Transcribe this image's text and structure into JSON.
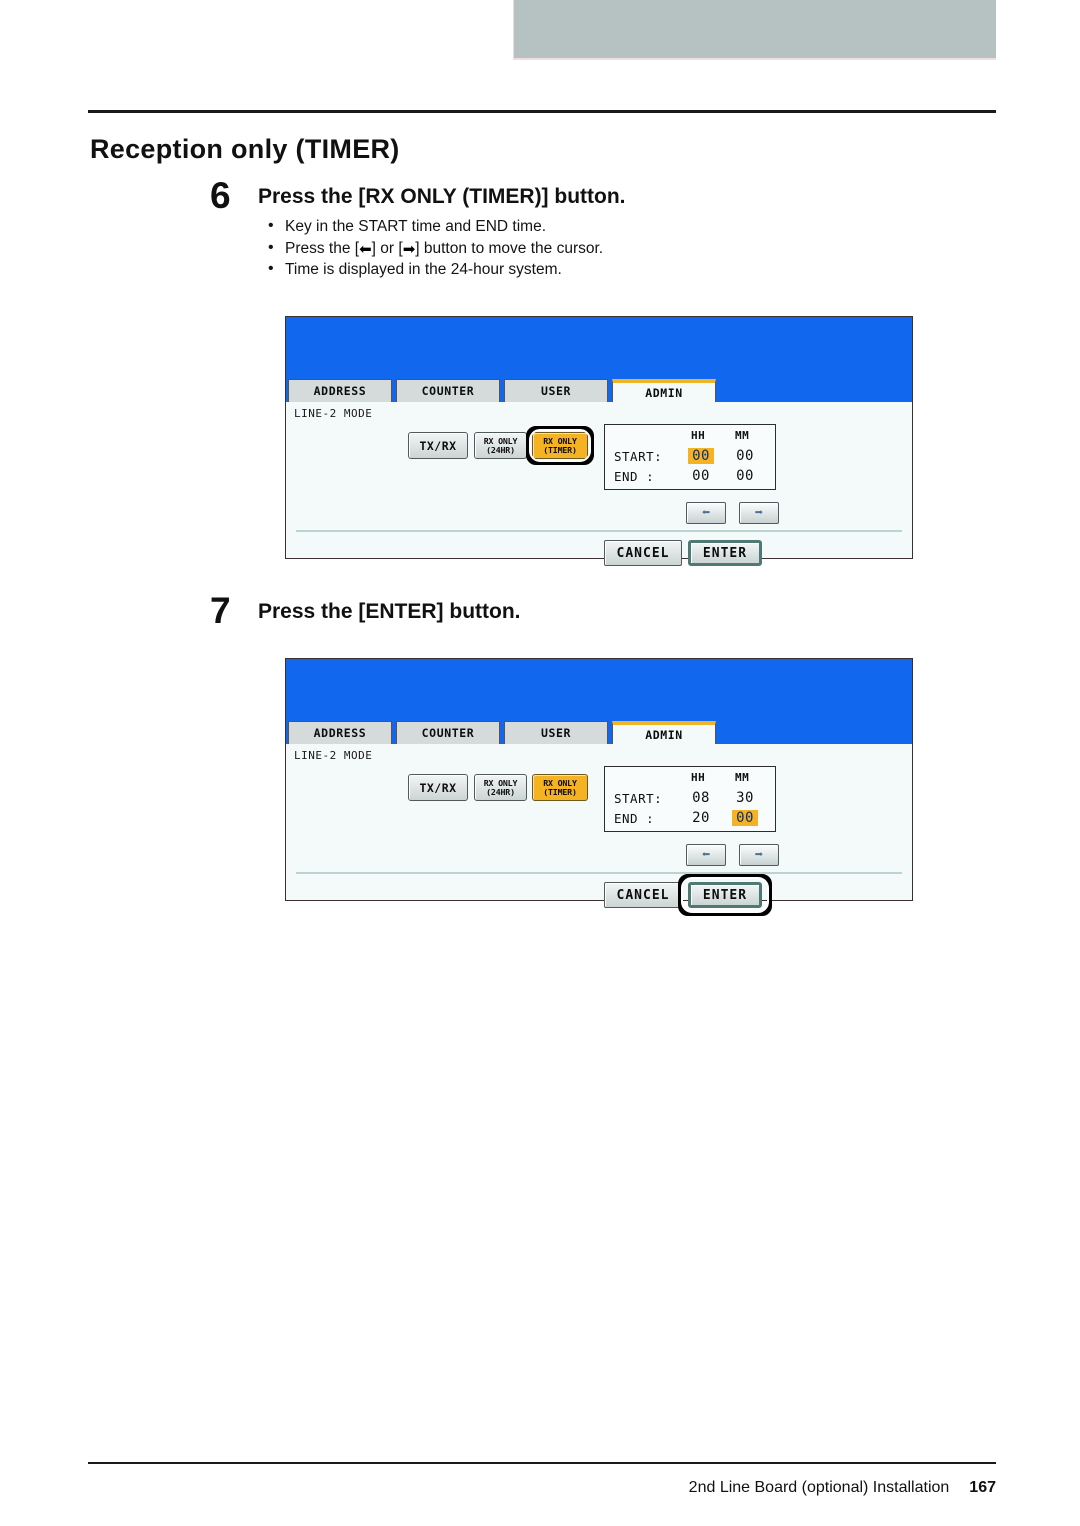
{
  "document": {
    "section_title": "Reception only (TIMER)",
    "footer_text": "2nd Line Board (optional) Installation",
    "footer_page": "167"
  },
  "steps": [
    {
      "number": "6",
      "title": "Press the [RX ONLY (TIMER)] button.",
      "bullets": [
        {
          "pre": "Key in the START time and END time.",
          "mid": "",
          "post": ""
        },
        {
          "pre": "Press the [",
          "left_arrow": "⬅",
          "mid": "] or [",
          "right_arrow": "➡",
          "post": "] button to move the cursor."
        },
        {
          "pre": "Time is displayed in the 24-hour system.",
          "mid": "",
          "post": ""
        }
      ]
    },
    {
      "number": "7",
      "title": "Press the [ENTER] button.",
      "bullets": []
    }
  ],
  "screens": [
    {
      "id": "screen-step6",
      "mode_label": "LINE-2 MODE",
      "tabs": [
        {
          "label": "ADDRESS",
          "active": false
        },
        {
          "label": "COUNTER",
          "active": false
        },
        {
          "label": "USER",
          "active": false
        },
        {
          "label": "ADMIN",
          "active": true
        }
      ],
      "mode_buttons": [
        {
          "line1": "TX/RX",
          "line2": "",
          "selected": false
        },
        {
          "line1": "RX ONLY",
          "line2": "(24HR)",
          "selected": false
        },
        {
          "line1": "RX ONLY",
          "line2": "(TIMER)",
          "selected": true
        }
      ],
      "time_table": {
        "col_hh": "HH",
        "col_mm": "MM",
        "start_label": "START:",
        "end_label": "END  :",
        "start_hh": "00",
        "start_mm": "00",
        "end_hh": "00",
        "end_mm": "00",
        "highlight": "start_hh"
      },
      "nav": {
        "left": "⬅",
        "right": "➡"
      },
      "footer_buttons": {
        "cancel": "CANCEL",
        "enter": "ENTER"
      },
      "callout_target": "rx-only-timer-button"
    },
    {
      "id": "screen-step7",
      "mode_label": "LINE-2 MODE",
      "tabs": [
        {
          "label": "ADDRESS",
          "active": false
        },
        {
          "label": "COUNTER",
          "active": false
        },
        {
          "label": "USER",
          "active": false
        },
        {
          "label": "ADMIN",
          "active": true
        }
      ],
      "mode_buttons": [
        {
          "line1": "TX/RX",
          "line2": "",
          "selected": false
        },
        {
          "line1": "RX ONLY",
          "line2": "(24HR)",
          "selected": false
        },
        {
          "line1": "RX ONLY",
          "line2": "(TIMER)",
          "selected": true
        }
      ],
      "time_table": {
        "col_hh": "HH",
        "col_mm": "MM",
        "start_label": "START:",
        "end_label": "END  :",
        "start_hh": "08",
        "start_mm": "30",
        "end_hh": "20",
        "end_mm": "00",
        "highlight": "end_mm"
      },
      "nav": {
        "left": "⬅",
        "right": "➡"
      },
      "footer_buttons": {
        "cancel": "CANCEL",
        "enter": "ENTER"
      },
      "callout_target": "enter-button"
    }
  ],
  "colors": {
    "lcd_blue": "#1168ee",
    "tab_active_accent": "#f0b429",
    "selected_button": "#f5b324",
    "header_bar": "#b6c2c2"
  }
}
